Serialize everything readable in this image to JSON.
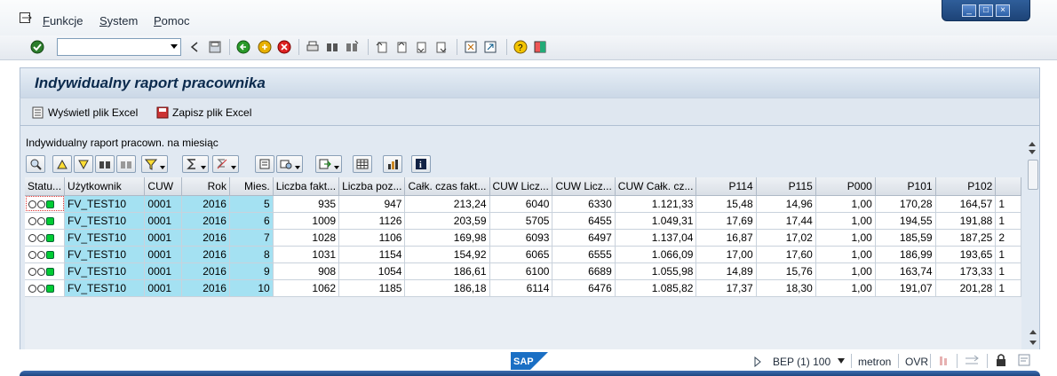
{
  "menu": {
    "items": [
      {
        "label": "Funkcje",
        "accel": "F",
        "rest": "unkcje"
      },
      {
        "label": "System",
        "accel": "S",
        "rest": "ystem"
      },
      {
        "label": "Pomoc",
        "accel": "P",
        "rest": "omoc"
      }
    ]
  },
  "window_buttons": {
    "minimize": "_",
    "maximize": "□",
    "close": "×"
  },
  "toolbar": {
    "command_field": {
      "value": "",
      "placeholder": ""
    }
  },
  "title": "Indywidualny raport pracownika",
  "app_toolbar": {
    "show_excel": "Wyświetl plik Excel",
    "save_excel": "Zapisz plik Excel"
  },
  "section_label": "Indywidualny raport pracown. na miesiąc",
  "grid": {
    "columns": [
      "Statu...",
      "Użytkownik",
      "CUW",
      "Rok",
      "Mies.",
      "Liczba fakt...",
      "Liczba poz...",
      "Całk. czas fakt...",
      "CUW Licz...",
      "CUW Licz...",
      "CUW Całk. cz...",
      "P114",
      "P115",
      "P000",
      "P101",
      "P102",
      ""
    ],
    "rows": [
      {
        "user": "FV_TEST10",
        "cuw": "0001",
        "rok": "2016",
        "mies": "5",
        "lf": "935",
        "lp": "947",
        "cc": "213,24",
        "cl1": "6040",
        "cl2": "6330",
        "ccc": "1.121,33",
        "p114": "15,48",
        "p115": "14,96",
        "p000": "1,00",
        "p101": "170,28",
        "p102": "164,57",
        "more": "1"
      },
      {
        "user": "FV_TEST10",
        "cuw": "0001",
        "rok": "2016",
        "mies": "6",
        "lf": "1009",
        "lp": "1126",
        "cc": "203,59",
        "cl1": "5705",
        "cl2": "6455",
        "ccc": "1.049,31",
        "p114": "17,69",
        "p115": "17,44",
        "p000": "1,00",
        "p101": "194,55",
        "p102": "191,88",
        "more": "1"
      },
      {
        "user": "FV_TEST10",
        "cuw": "0001",
        "rok": "2016",
        "mies": "7",
        "lf": "1028",
        "lp": "1106",
        "cc": "169,98",
        "cl1": "6093",
        "cl2": "6497",
        "ccc": "1.137,04",
        "p114": "16,87",
        "p115": "17,02",
        "p000": "1,00",
        "p101": "185,59",
        "p102": "187,25",
        "more": "2"
      },
      {
        "user": "FV_TEST10",
        "cuw": "0001",
        "rok": "2016",
        "mies": "8",
        "lf": "1031",
        "lp": "1154",
        "cc": "154,92",
        "cl1": "6065",
        "cl2": "6555",
        "ccc": "1.066,09",
        "p114": "17,00",
        "p115": "17,60",
        "p000": "1,00",
        "p101": "186,99",
        "p102": "193,65",
        "more": "1"
      },
      {
        "user": "FV_TEST10",
        "cuw": "0001",
        "rok": "2016",
        "mies": "9",
        "lf": "908",
        "lp": "1054",
        "cc": "186,61",
        "cl1": "6100",
        "cl2": "6689",
        "ccc": "1.055,98",
        "p114": "14,89",
        "p115": "15,76",
        "p000": "1,00",
        "p101": "163,74",
        "p102": "173,33",
        "more": "1"
      },
      {
        "user": "FV_TEST10",
        "cuw": "0001",
        "rok": "2016",
        "mies": "10",
        "lf": "1062",
        "lp": "1185",
        "cc": "186,18",
        "cl1": "6114",
        "cl2": "6476",
        "ccc": "1.085,82",
        "p114": "17,37",
        "p115": "18,30",
        "p000": "1,00",
        "p101": "191,07",
        "p102": "201,28",
        "more": "1"
      }
    ]
  },
  "statusbar": {
    "system": "BEP (1) 100",
    "host": "metron",
    "mode": "OVR"
  },
  "colors": {
    "key_cell": "#a4e1f2",
    "title_text": "#0b2a4d",
    "status_green": "#00cc33"
  }
}
